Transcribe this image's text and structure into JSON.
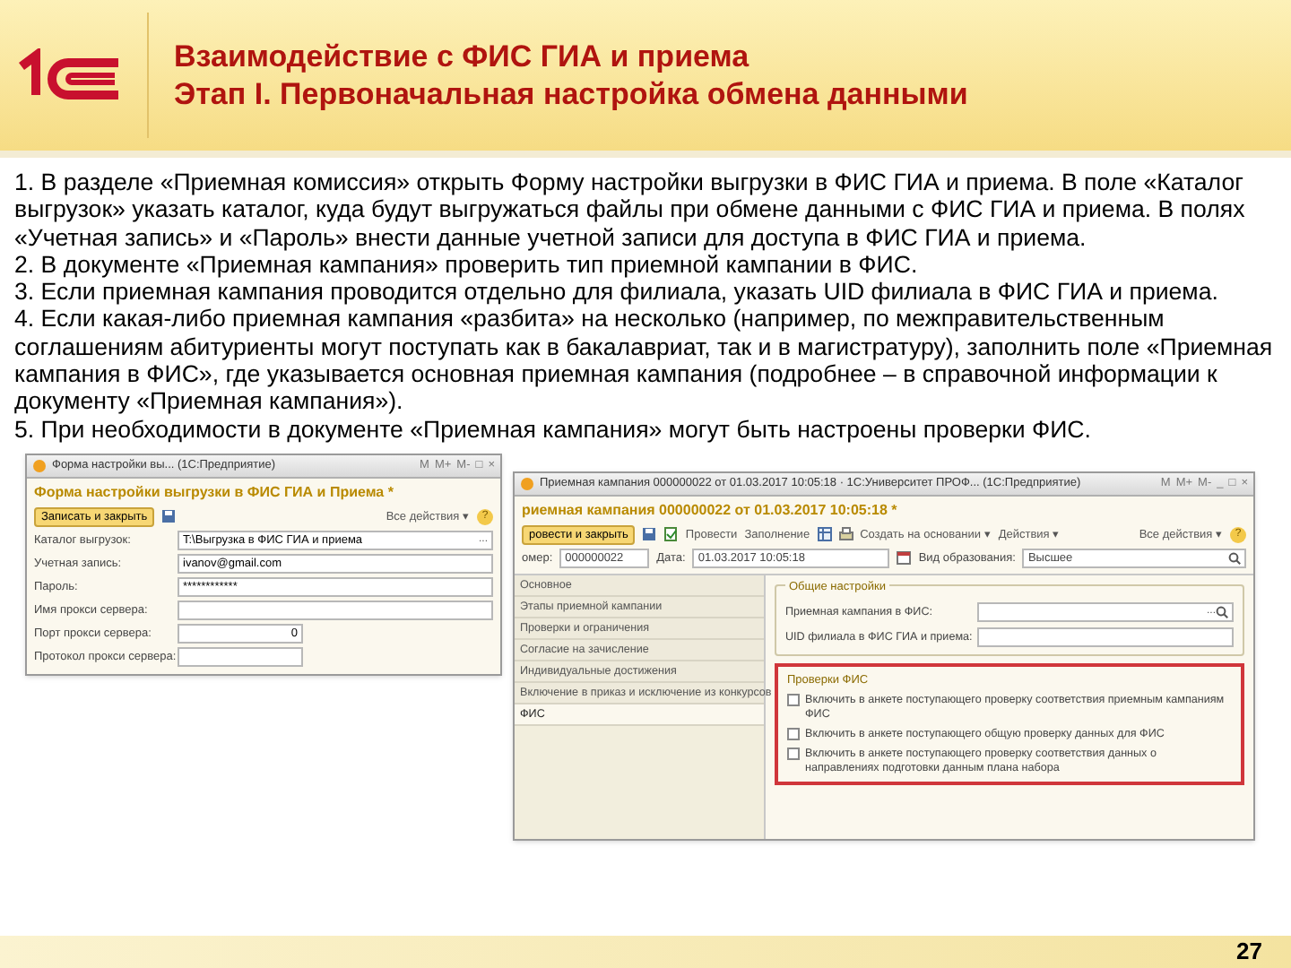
{
  "slide": {
    "title_lines": [
      "Взаимодействие с ФИС ГИА и приема",
      "Этап I. Первоначальная настройка обмена данными"
    ],
    "page_number": "27"
  },
  "paragraphs": [
    "1. В разделе «Приемная комиссия» открыть Форму настройки выгрузки в ФИС ГИА и приема. В поле «Каталог выгрузок» указать каталог, куда будут выгружаться файлы при обмене данными с ФИС ГИА и приема. В полях «Учетная запись» и «Пароль» внести данные учетной записи для доступа в ФИС ГИА и приема.",
    "2. В документе «Приемная кампания» проверить тип приемной кампании в ФИС.",
    "3. Если приемная кампания проводится отдельно для филиала, указать UID филиала в ФИС ГИА и приема.",
    "4. Если какая-либо приемная кампания «разбита» на несколько (например, по межправительственным соглашениям абитуриенты могут поступать как в бакалавриат, так и в магистратуру), заполнить поле «Приемная кампания в ФИС», где указывается основная приемная кампания (подробнее – в справочной информации к документу «Приемная кампания»).",
    "5. При необходимости в документе «Приемная кампания» могут быть настроены проверки ФИС."
  ],
  "settings_window": {
    "title": "Форма настройки вы... (1С:Предприятие)",
    "title_buttons": [
      "M",
      "M+",
      "M-",
      "□",
      "×"
    ],
    "heading": "Форма настройки выгрузки в ФИС ГИА и Приема *",
    "save_close_button": "Записать и закрыть",
    "all_actions": "Все действия ▾",
    "help": "?",
    "fields": [
      {
        "label": "Каталог выгрузок:",
        "value": "T:\\Выгрузка в ФИС ГИА и приема",
        "kind": "choice",
        "choice": "..."
      },
      {
        "label": "Учетная запись:",
        "value": "ivanov@gmail.com",
        "kind": "text"
      },
      {
        "label": "Пароль:",
        "value": "************",
        "kind": "text"
      },
      {
        "label": "Имя прокси сервера:",
        "kind": "text"
      },
      {
        "label": "Порт прокси сервера:",
        "value": "0",
        "kind": "number"
      },
      {
        "label": "Протокол прокси сервера:",
        "kind": "number"
      }
    ]
  },
  "campaign_window": {
    "title": "Приемная кампания 000000022 от 01.03.2017 10:05:18 · 1С:Университет ПРОФ... (1С:Предприятие)",
    "title_buttons": [
      "M",
      "M+",
      "M-",
      "_",
      "□",
      "×"
    ],
    "heading": "риемная кампания 000000022 от 01.03.2017 10:05:18 *",
    "toolbar": {
      "post_close_button": "ровести и закрыть",
      "post": "Провести",
      "fill": "Заполнение",
      "create_based_on": "Создать на основании ▾",
      "actions": "Действия ▾",
      "all_actions": "Все действия ▾",
      "help": "?"
    },
    "number_label": "омер:",
    "number": "000000022",
    "date_label": "Дата:",
    "date": "01.03.2017 10:05:18",
    "education_label": "Вид образования:",
    "education": "Высшее",
    "nav": [
      {
        "label": "Основное",
        "selected": false
      },
      {
        "label": "Этапы приемной кампании",
        "selected": false
      },
      {
        "label": "Проверки и ограничения",
        "selected": false
      },
      {
        "label": "Согласие на зачисление",
        "selected": false
      },
      {
        "label": "Индивидуальные достижения",
        "selected": false
      },
      {
        "label": "Включение в приказ и исключение из конкурсов",
        "selected": false
      },
      {
        "label": "ФИС",
        "selected": true
      }
    ],
    "general_group": {
      "title": "Общие настройки",
      "fields": [
        {
          "label": "Приемная кампания в ФИС:",
          "choice": "..."
        },
        {
          "label": "UID филиала в ФИС ГИА и приема:"
        }
      ]
    },
    "checks_group": {
      "title": "Проверки ФИС",
      "items": [
        {
          "label": "Включить в анкете поступающего проверку соответствия приемным кампаниям ФИС",
          "checked": false
        },
        {
          "label": "Включить в анкете поступающего общую проверку данных для ФИС",
          "checked": false
        },
        {
          "label": "Включить в анкете поступающего проверку соответствия данных о направлениях подготовки данным плана набора",
          "checked": false
        }
      ]
    }
  }
}
